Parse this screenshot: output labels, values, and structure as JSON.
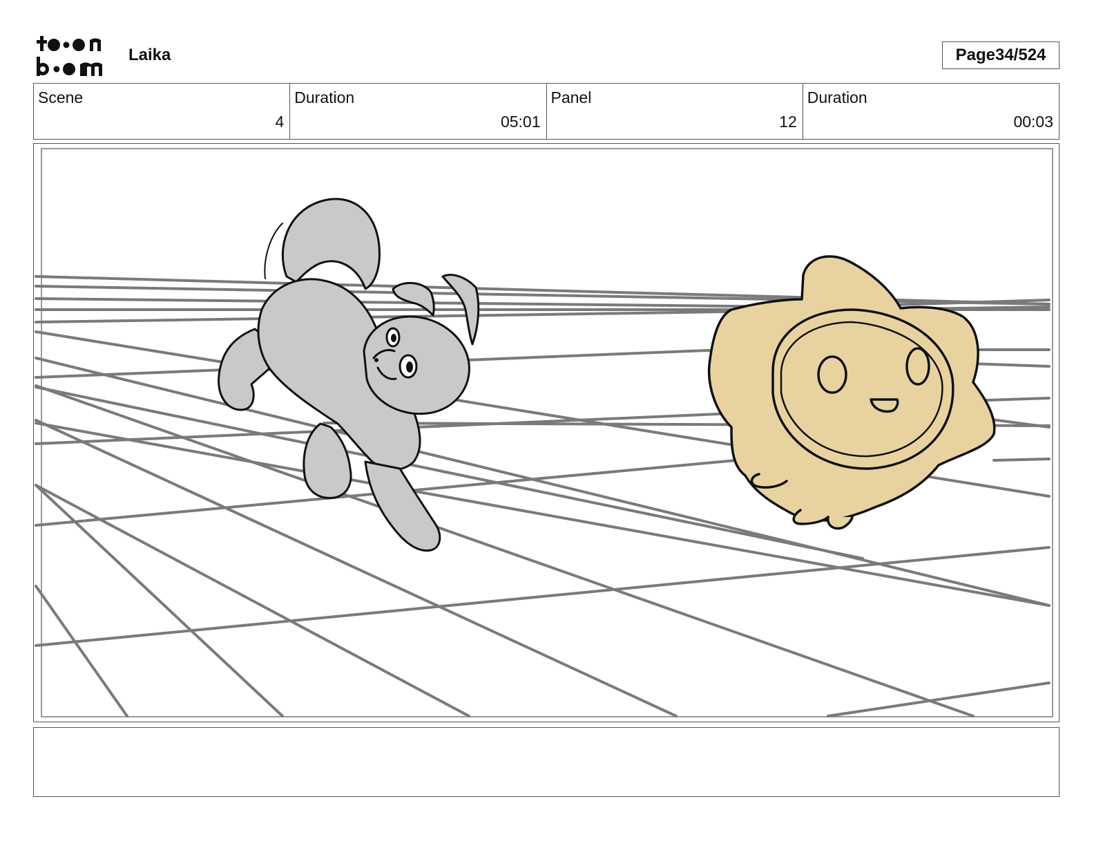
{
  "header": {
    "logo_text_top": "toon",
    "logo_text_bottom": "boom",
    "project_title": "Laika",
    "page_label": "Page",
    "page_value": "34/524"
  },
  "info": {
    "scene_label": "Scene",
    "scene_value": "4",
    "scene_duration_label": "Duration",
    "scene_duration_value": "05:01",
    "panel_label": "Panel",
    "panel_value": "12",
    "panel_duration_label": "Duration",
    "panel_duration_value": "00:03"
  },
  "colors": {
    "dog_fill": "#c9c9c9",
    "star_fill": "#e8d3a0",
    "grid_line": "#7a7a7a",
    "ink": "#111111"
  },
  "notes": {
    "text": ""
  }
}
